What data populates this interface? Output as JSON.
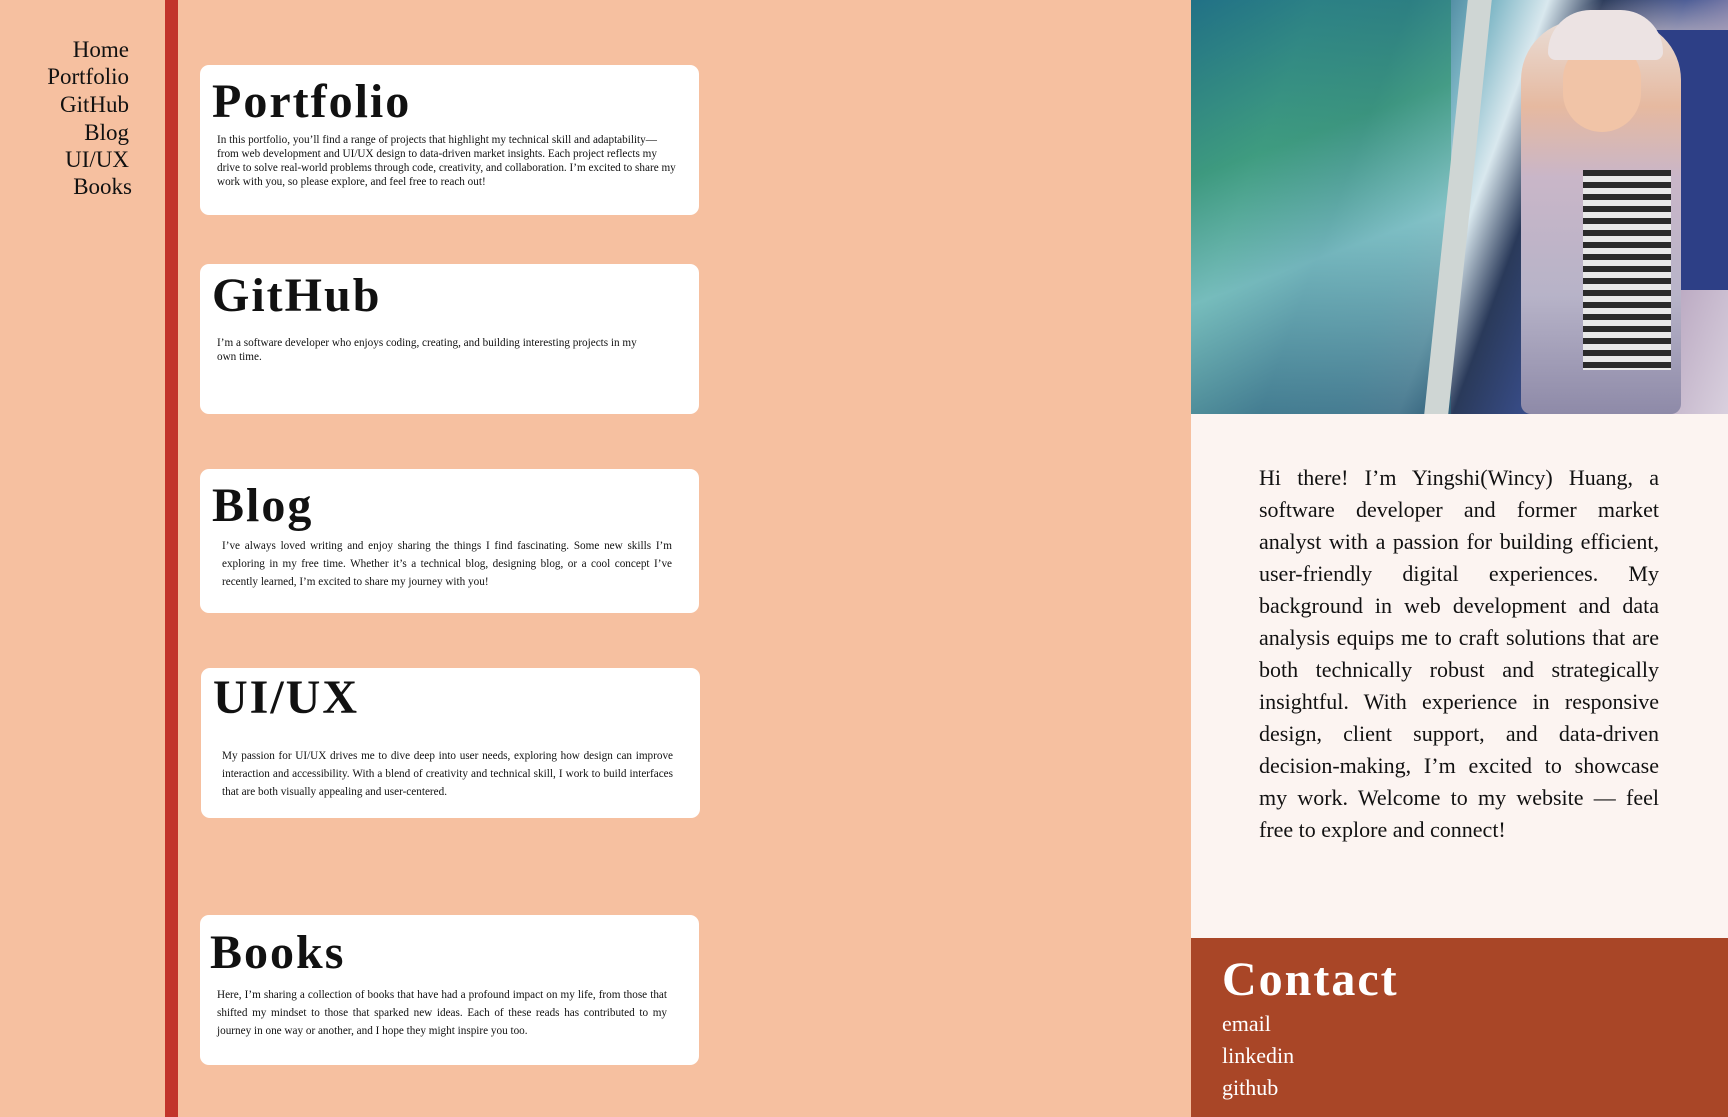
{
  "colors": {
    "background": "#f6c0a0",
    "divider": "#c2342b",
    "card": "#ffffff",
    "about_bg": "#fcf4f1",
    "contact_bg": "#a94627"
  },
  "nav": {
    "items": [
      "Home",
      "Portfolio",
      "GitHub",
      "Blog",
      "UI/UX",
      "Books"
    ]
  },
  "cards": {
    "portfolio": {
      "title": "Portfolio",
      "text": "In this portfolio, you’ll find a range of projects that highlight my technical skill and adaptability—from web development and UI/UX design to data-driven market insights. Each project reflects my drive to solve real-world problems through code, creativity, and collaboration. I’m excited to share my work with you, so please explore, and feel free to reach out!"
    },
    "github": {
      "title": "GitHub",
      "text": "I’m a software developer who enjoys coding, creating, and building interesting projects in my own time."
    },
    "blog": {
      "title": "Blog",
      "text": "I’ve always loved writing and enjoy sharing the things I find fascinating. Some new skills I’m exploring  in my free time. Whether it’s a technical blog, designing blog, or a cool concept I’ve recently learned, I’m excited to share my journey with you!"
    },
    "uiux": {
      "title": "UI/UX",
      "text": "My passion for UI/UX drives me to dive deep into user needs, exploring how design can improve interaction and accessibility. With a blend of creativity and technical skill, I work to build interfaces that are both visually appealing and user-centered."
    },
    "books": {
      "title": "Books",
      "text": "Here, I’m sharing a collection of books that have had a profound impact on my life, from those that shifted my mindset to those that sparked new ideas. Each of these reads has contributed to my journey in one way or another, and I hope they might inspire you too."
    }
  },
  "about": {
    "text": "Hi there! I’m Yingshi(Wincy) Huang, a software developer and former market analyst with a passion for building efficient, user-friendly digital experiences. My background in web development and data analysis equips me to craft solutions that are both technically robust and strategically insightful. With experience in responsive design, client support, and data-driven decision-making, I’m excited to showcase my work. Welcome to my website — feel free to explore and connect!"
  },
  "contact": {
    "title": "Contact",
    "links": [
      "email",
      "linkedin",
      "github"
    ]
  }
}
